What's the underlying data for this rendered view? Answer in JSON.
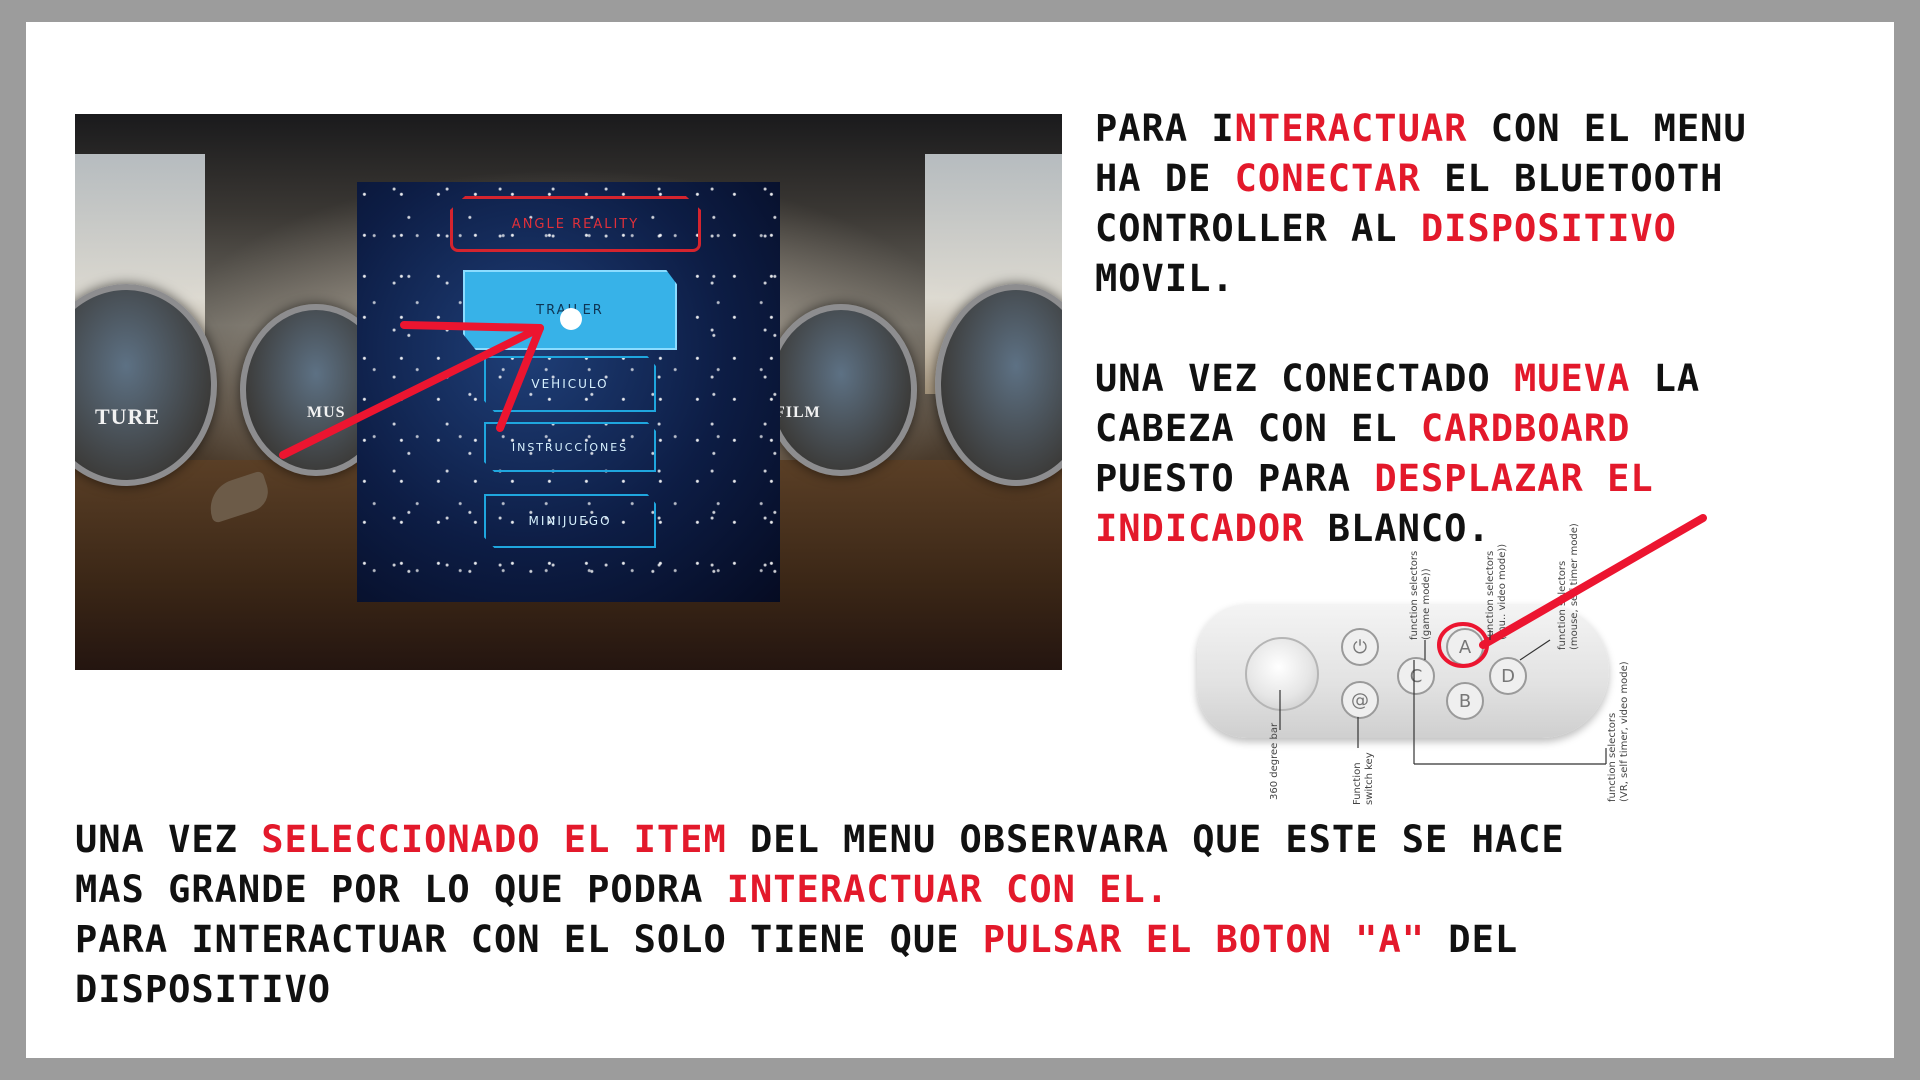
{
  "colors": {
    "highlight": "#e3192b",
    "text": "#111111",
    "frame": "#9c9c9c",
    "menu_accent": "#37b2e8",
    "menu_title_border": "#d4242e"
  },
  "vr": {
    "discs": {
      "left_partial": "TURE",
      "music": "MUS",
      "film": "FILM"
    },
    "menu": {
      "title": "ANGLE REALITY",
      "buttons": [
        "TRAILER",
        "VEHICULO",
        "INSTRUCCIONES",
        "MINIJUEGO"
      ]
    }
  },
  "instructions_top": [
    [
      {
        "t": "Para I"
      },
      {
        "t": "nteractuar",
        "hl": true
      },
      {
        "t": " con el menu"
      }
    ],
    [
      {
        "t": "ha de "
      },
      {
        "t": "conectar",
        "hl": true
      },
      {
        "t": " el bluetooth"
      }
    ],
    [
      {
        "t": "controller al "
      },
      {
        "t": "dispositivo",
        "hl": true
      }
    ],
    [
      {
        "t": "movil."
      }
    ],
    [
      {
        "t": ""
      }
    ],
    [
      {
        "t": "Una vez conectado "
      },
      {
        "t": "mueva",
        "hl": true
      },
      {
        "t": " la"
      }
    ],
    [
      {
        "t": "cabeza con el "
      },
      {
        "t": "cardboard",
        "hl": true
      }
    ],
    [
      {
        "t": "puesto para "
      },
      {
        "t": "desplazar el",
        "hl": true
      }
    ],
    [
      {
        "t": "indicador",
        "hl": true
      },
      {
        "t": " blanco."
      }
    ]
  ],
  "instructions_bottom": [
    [
      {
        "t": "Una vez "
      },
      {
        "t": "seleccionado el item",
        "hl": true
      },
      {
        "t": " del menu observara que este se hace"
      }
    ],
    [
      {
        "t": "mas grande por lo que podra "
      },
      {
        "t": "interactuar con el.",
        "hl": true
      }
    ],
    [
      {
        "t": "Para interactuar con el solo tiene que "
      },
      {
        "t": "pulsar el boton \"A\"",
        "hl": true
      },
      {
        "t": " del"
      }
    ],
    [
      {
        "t": "dispositivo"
      }
    ]
  ],
  "controller": {
    "buttons": {
      "power": "⏻",
      "at": "@",
      "a": "A",
      "b": "B",
      "c": "C",
      "d": "D"
    },
    "labels": {
      "degree_bar": "360 degree bar",
      "switch_key_1": "Function",
      "switch_key_2": "switch key",
      "game_mode_1": "function selectors",
      "game_mode_2": "(game mode))",
      "music_mode_1": "function selectors",
      "music_mode_2": "(mu.. video mode))",
      "mouse_mode_1": "function selectors",
      "mouse_mode_2": "(mouse, self timer mode)",
      "vr_mode_1": "function selectors",
      "vr_mode_2": "(VR, self timer, video mode)"
    }
  }
}
